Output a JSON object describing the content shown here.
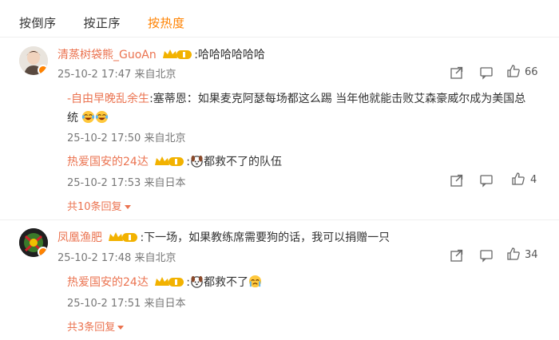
{
  "tabs": [
    {
      "label": "按倒序"
    },
    {
      "label": "按正序"
    },
    {
      "label": "按热度",
      "active": true
    }
  ],
  "comments": [
    {
      "user": "清蒸树袋熊_GuoAn",
      "text": ":哈哈哈哈哈哈",
      "time": "25-10-2 17:47",
      "location": "来自北京",
      "likes": "66",
      "replies": [
        {
          "user": "-自由早晚乱余生",
          "text_line1": ":塞蒂恩：如果麦克阿瑟每场都这么踢 当年他就能击败艾森豪威尔成为美国总",
          "text_line2": "统",
          "time": "25-10-2 17:50",
          "location": "来自北京",
          "emojis": [
            "laugh-cry-emoji",
            "laugh-cry-emoji"
          ]
        },
        {
          "user": "热爱国安的24达",
          "text": "都救不了的队伍",
          "time": "25-10-2 17:53",
          "location": "来自日本",
          "likes": "4"
        }
      ],
      "more_replies": "共10条回复"
    },
    {
      "user": "凤凰渔肥",
      "text": ":下一场，如果教练席需要狗的话，我可以捐赠一只",
      "time": "25-10-2 17:48",
      "location": "来自北京",
      "likes": "34",
      "replies": [
        {
          "user": "热爱国安的24达",
          "text": "都救不了",
          "time": "25-10-2 17:51",
          "location": "来自日本"
        }
      ],
      "more_replies": "共3条回复"
    }
  ],
  "colors": {
    "accent": "#ff8200",
    "username": "#eb7350",
    "meta": "#777777",
    "reply_bg": "#f7f7f7"
  },
  "icons": [
    "share-icon",
    "comment-icon",
    "like-icon",
    "level-crown-badge",
    "verified-badge"
  ]
}
